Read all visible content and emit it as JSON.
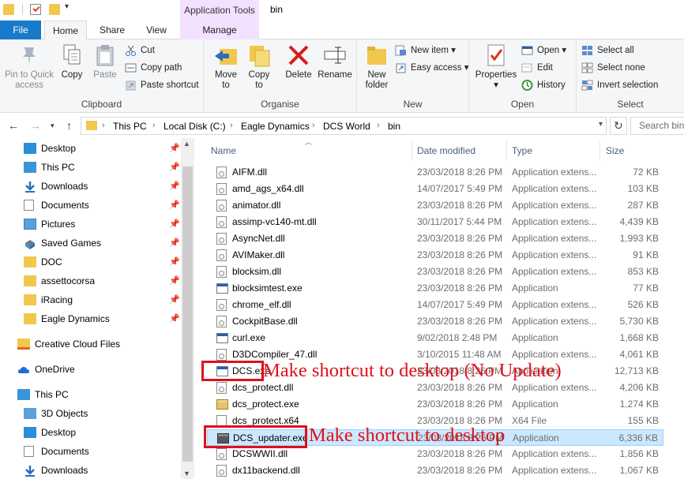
{
  "window": {
    "title": "bin",
    "contextual_tab_title": "Application Tools"
  },
  "tabs": {
    "file": "File",
    "home": "Home",
    "share": "Share",
    "view": "View",
    "manage": "Manage"
  },
  "ribbon": {
    "clipboard": {
      "label": "Clipboard",
      "pin_line1": "Pin to Quick",
      "pin_line2": "access",
      "copy": "Copy",
      "paste": "Paste",
      "cut": "Cut",
      "copy_path": "Copy path",
      "paste_shortcut": "Paste shortcut"
    },
    "organise": {
      "label": "Organise",
      "move_to_line1": "Move",
      "move_to_line2": "to",
      "copy_to_line1": "Copy",
      "copy_to_line2": "to",
      "delete": "Delete",
      "rename": "Rename"
    },
    "new": {
      "label": "New",
      "new_folder_line1": "New",
      "new_folder_line2": "folder",
      "new_item": "New item",
      "easy_access": "Easy access"
    },
    "open": {
      "label": "Open",
      "properties": "Properties",
      "open": "Open",
      "edit": "Edit",
      "history": "History"
    },
    "select": {
      "label": "Select",
      "select_all": "Select all",
      "select_none": "Select none",
      "invert_selection": "Invert selection"
    }
  },
  "address": {
    "crumbs": [
      "This PC",
      "Local Disk (C:)",
      "Eagle Dynamics",
      "DCS World",
      "bin"
    ],
    "search_placeholder": "Search bin"
  },
  "nav_pane": {
    "quick_access": [
      "Desktop",
      "This PC",
      "Downloads",
      "Documents",
      "Pictures",
      "Saved Games",
      "DOC",
      "assettocorsa",
      "iRacing",
      "Eagle Dynamics"
    ],
    "creative_cloud": "Creative Cloud Files",
    "onedrive": "OneDrive",
    "this_pc": "This PC",
    "this_pc_children": [
      "3D Objects",
      "Desktop",
      "Documents",
      "Downloads"
    ]
  },
  "columns": {
    "name": "Name",
    "date_modified": "Date modified",
    "type": "Type",
    "size": "Size"
  },
  "files": [
    {
      "name": "AIFM.dll",
      "date": "23/03/2018 8:26 PM",
      "type": "Application extens...",
      "size": "72 KB",
      "kind": "dll"
    },
    {
      "name": "amd_ags_x64.dll",
      "date": "14/07/2017 5:49 PM",
      "type": "Application extens...",
      "size": "103 KB",
      "kind": "dll"
    },
    {
      "name": "animator.dll",
      "date": "23/03/2018 8:26 PM",
      "type": "Application extens...",
      "size": "287 KB",
      "kind": "dll"
    },
    {
      "name": "assimp-vc140-mt.dll",
      "date": "30/11/2017 5:44 PM",
      "type": "Application extens...",
      "size": "4,439 KB",
      "kind": "dll"
    },
    {
      "name": "AsyncNet.dll",
      "date": "23/03/2018 8:26 PM",
      "type": "Application extens...",
      "size": "1,993 KB",
      "kind": "dll"
    },
    {
      "name": "AVIMaker.dll",
      "date": "23/03/2018 8:26 PM",
      "type": "Application extens...",
      "size": "91 KB",
      "kind": "dll"
    },
    {
      "name": "blocksim.dll",
      "date": "23/03/2018 8:26 PM",
      "type": "Application extens...",
      "size": "853 KB",
      "kind": "dll"
    },
    {
      "name": "blocksimtest.exe",
      "date": "23/03/2018 8:26 PM",
      "type": "Application",
      "size": "77 KB",
      "kind": "exe"
    },
    {
      "name": "chrome_elf.dll",
      "date": "14/07/2017 5:49 PM",
      "type": "Application extens...",
      "size": "526 KB",
      "kind": "dll"
    },
    {
      "name": "CockpitBase.dll",
      "date": "23/03/2018 8:26 PM",
      "type": "Application extens...",
      "size": "5,730 KB",
      "kind": "dll"
    },
    {
      "name": "curl.exe",
      "date": "9/02/2018 2:48 PM",
      "type": "Application",
      "size": "1,668 KB",
      "kind": "exe"
    },
    {
      "name": "D3DCompiler_47.dll",
      "date": "3/10/2015 11:48 AM",
      "type": "Application extens...",
      "size": "4,061 KB",
      "kind": "dll"
    },
    {
      "name": "DCS.exe",
      "date": "23/03/2018 8:26 PM",
      "type": "Application",
      "size": "12,713 KB",
      "kind": "exe"
    },
    {
      "name": "dcs_protect.dll",
      "date": "23/03/2018 8:26 PM",
      "type": "Application extens...",
      "size": "4,206 KB",
      "kind": "dll"
    },
    {
      "name": "dcs_protect.exe",
      "date": "23/03/2018 8:26 PM",
      "type": "Application",
      "size": "1,274 KB",
      "kind": "prot"
    },
    {
      "name": "dcs_protect.x64",
      "date": "23/03/2018 8:26 PM",
      "type": "X64 File",
      "size": "155 KB",
      "kind": "file"
    },
    {
      "name": "DCS_updater.exe",
      "date": "23/03/2018 8:26 PM",
      "type": "Application",
      "size": "6,336 KB",
      "kind": "dcs",
      "selected": true
    },
    {
      "name": "DCSWWII.dll",
      "date": "23/03/2018 8:26 PM",
      "type": "Application extens...",
      "size": "1,856 KB",
      "kind": "dll"
    },
    {
      "name": "dx11backend.dll",
      "date": "23/03/2018 8:26 PM",
      "type": "Application extens...",
      "size": "1,067 KB",
      "kind": "dll"
    }
  ],
  "annotations": {
    "dcs_exe": "Make shortcut to desktop (No Update)",
    "dcs_updater": "Make shortcut to desktop"
  }
}
